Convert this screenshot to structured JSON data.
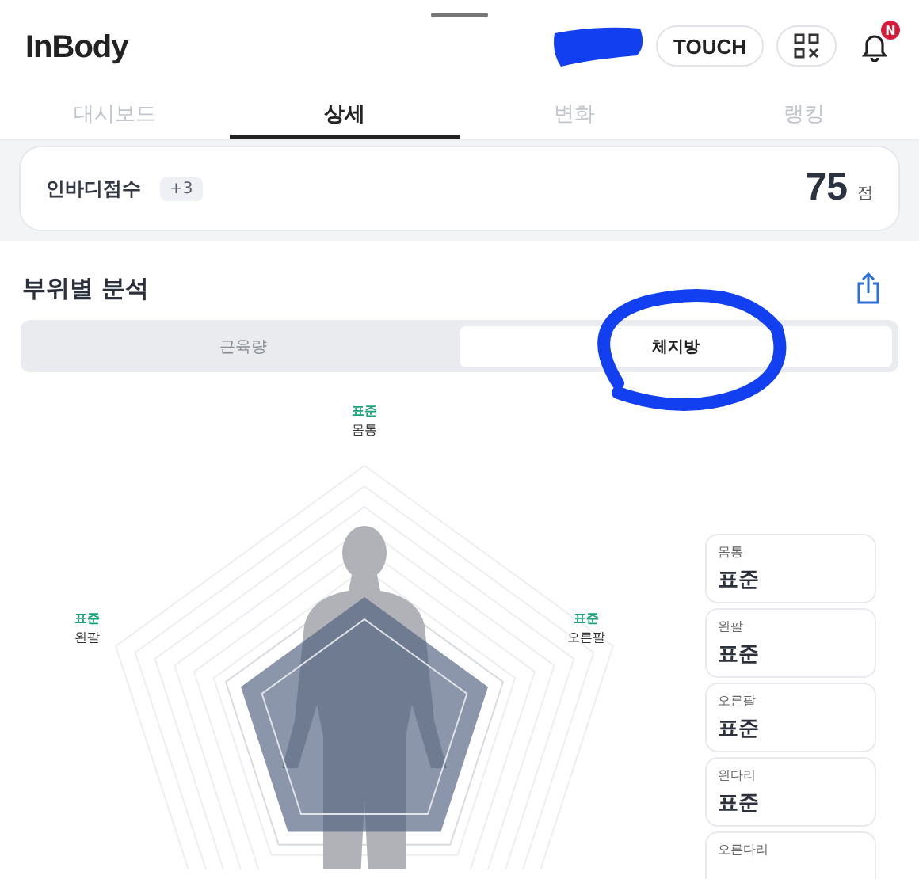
{
  "header": {
    "logo": "InBody",
    "touch_button": "TOUCH",
    "notification_badge": "N"
  },
  "tabs": [
    {
      "label": "대시보드",
      "selected": false
    },
    {
      "label": "상세",
      "selected": true
    },
    {
      "label": "변화",
      "selected": false
    },
    {
      "label": "랭킹",
      "selected": false
    }
  ],
  "score": {
    "label": "인바디점수",
    "change": "+3",
    "value": "75",
    "unit": "점"
  },
  "section": {
    "title": "부위별 분석",
    "segments": [
      {
        "label": "근육량",
        "selected": false
      },
      {
        "label": "체지방",
        "selected": true
      }
    ]
  },
  "radar_labels": [
    {
      "status": "표준",
      "part": "몸통"
    },
    {
      "status": "표준",
      "part": "왼팔"
    },
    {
      "status": "표준",
      "part": "오른팔"
    }
  ],
  "cards": [
    {
      "part": "몸통",
      "status": "표준"
    },
    {
      "part": "왼팔",
      "status": "표준"
    },
    {
      "part": "오른팔",
      "status": "표준"
    },
    {
      "part": "왼다리",
      "status": "표준"
    },
    {
      "part": "오른다리"
    }
  ]
}
